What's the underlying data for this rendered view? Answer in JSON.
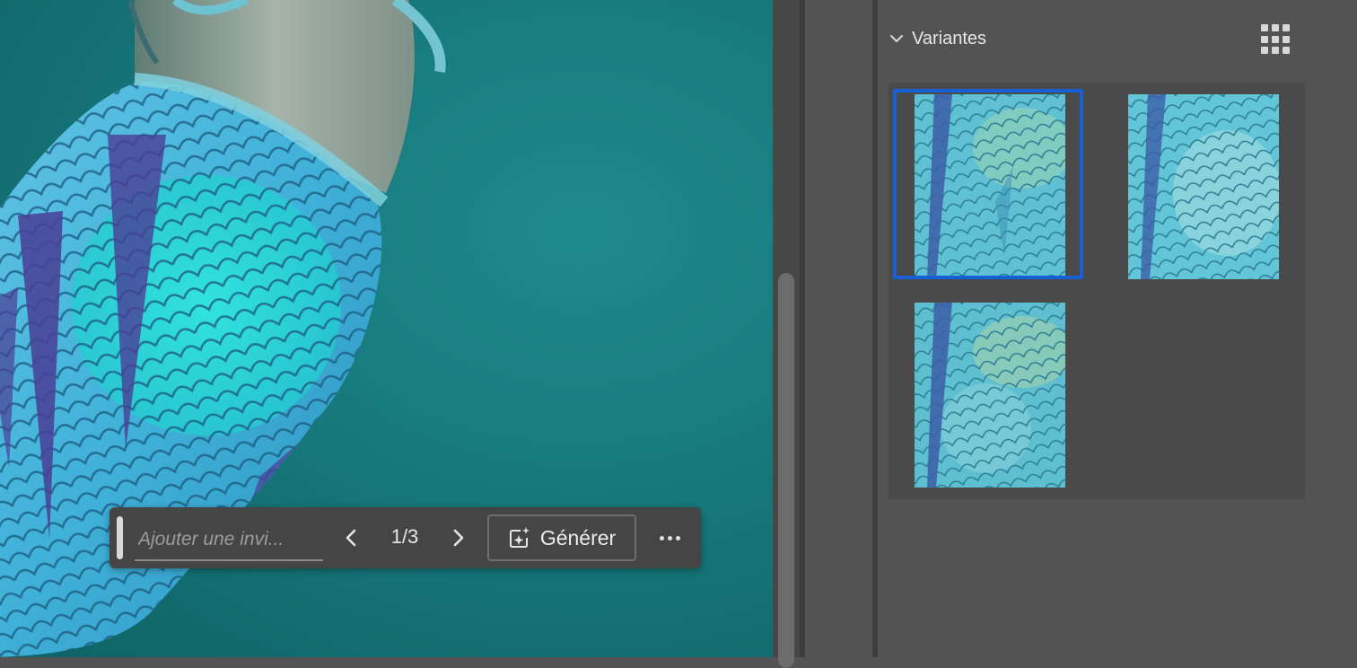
{
  "panel": {
    "title": "Variantes",
    "selected_index": 0,
    "variants": [
      {
        "icon": "variant-thumbnail"
      },
      {
        "icon": "variant-thumbnail"
      },
      {
        "icon": "variant-thumbnail"
      }
    ]
  },
  "taskbar": {
    "prompt_placeholder": "Ajouter une invi...",
    "counter": "1/3",
    "generate_label": "Générer",
    "generate_icon": "sparkle-generate-icon",
    "more_icon": "more-horizontal-icon"
  },
  "colors": {
    "accent": "#1560d4",
    "panel_bg": "#535353",
    "water": "#17787b"
  }
}
